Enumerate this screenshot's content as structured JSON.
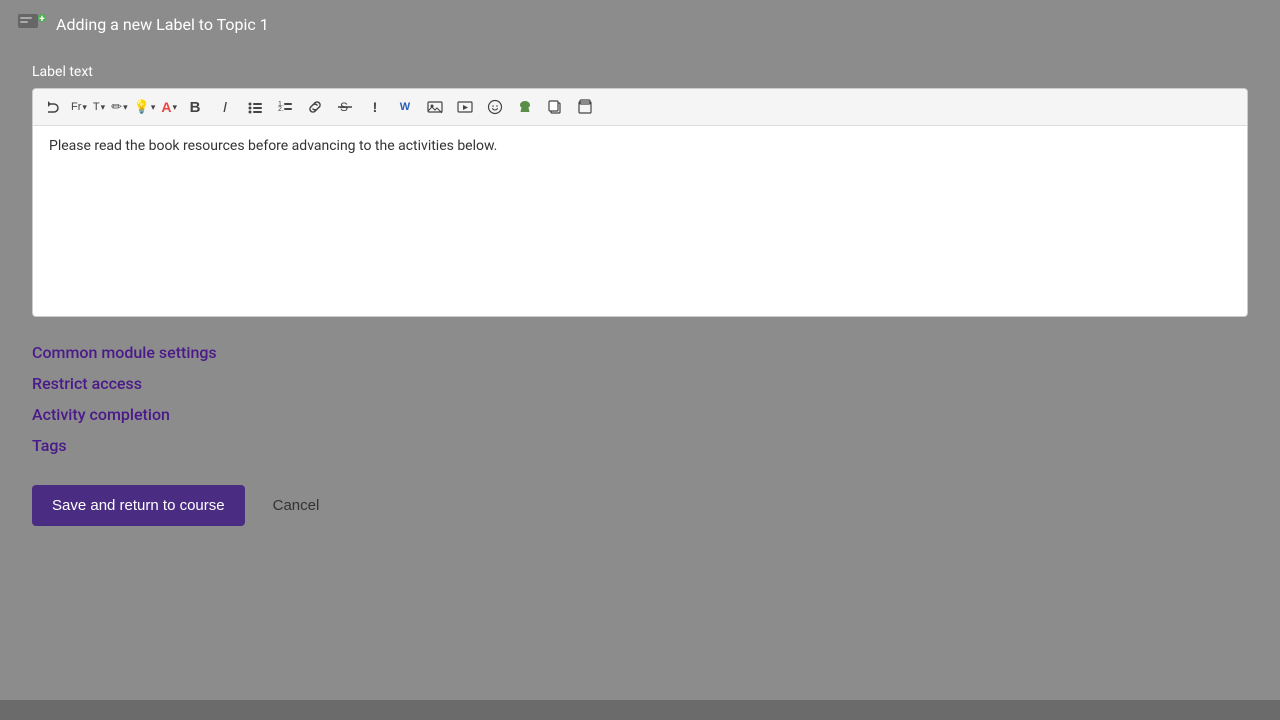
{
  "header": {
    "title": "Adding a new Label to Topic 1"
  },
  "editor": {
    "label": "Label text",
    "content": "Please read the book resources before advancing to the activities below.",
    "toolbar": [
      {
        "id": "t1",
        "symbol": "↓",
        "title": "Undo"
      },
      {
        "id": "t2",
        "symbol": "Fr",
        "arrow": true,
        "title": "Font family"
      },
      {
        "id": "t3",
        "symbol": "T",
        "arrow": true,
        "title": "Font size"
      },
      {
        "id": "t4",
        "symbol": "✏",
        "arrow": true,
        "title": "Highlight"
      },
      {
        "id": "t5",
        "symbol": "💡",
        "arrow": true,
        "title": "Format"
      },
      {
        "id": "t6",
        "symbol": "A",
        "arrow": true,
        "title": "Text color"
      },
      {
        "id": "t7",
        "symbol": "B",
        "title": "Bold"
      },
      {
        "id": "t8",
        "symbol": "I",
        "title": "Italic"
      },
      {
        "id": "t9",
        "symbol": "☰",
        "title": "Unordered list"
      },
      {
        "id": "t10",
        "symbol": "≡",
        "title": "Ordered list"
      },
      {
        "id": "t11",
        "symbol": "🔗",
        "title": "Link"
      },
      {
        "id": "t12",
        "symbol": "✂",
        "title": "Cut"
      },
      {
        "id": "t13",
        "symbol": "!",
        "title": "Special char"
      },
      {
        "id": "t14",
        "symbol": "W",
        "title": "Word"
      },
      {
        "id": "t15",
        "symbol": "🖼",
        "title": "Image"
      },
      {
        "id": "t16",
        "symbol": "📷",
        "title": "Media"
      },
      {
        "id": "t17",
        "symbol": "✳",
        "title": "Emoticon"
      },
      {
        "id": "t18",
        "symbol": "🌿",
        "title": "Insert"
      },
      {
        "id": "t19",
        "symbol": "⧉",
        "title": "Paste"
      },
      {
        "id": "t20",
        "symbol": "📋",
        "title": "Paste text"
      }
    ]
  },
  "sections": [
    {
      "id": "common-module-settings",
      "label": "Common module settings"
    },
    {
      "id": "restrict-access",
      "label": "Restrict access"
    },
    {
      "id": "activity-completion",
      "label": "Activity completion"
    },
    {
      "id": "tags",
      "label": "Tags"
    }
  ],
  "actions": {
    "save_label": "Save and return to course",
    "cancel_label": "Cancel"
  }
}
